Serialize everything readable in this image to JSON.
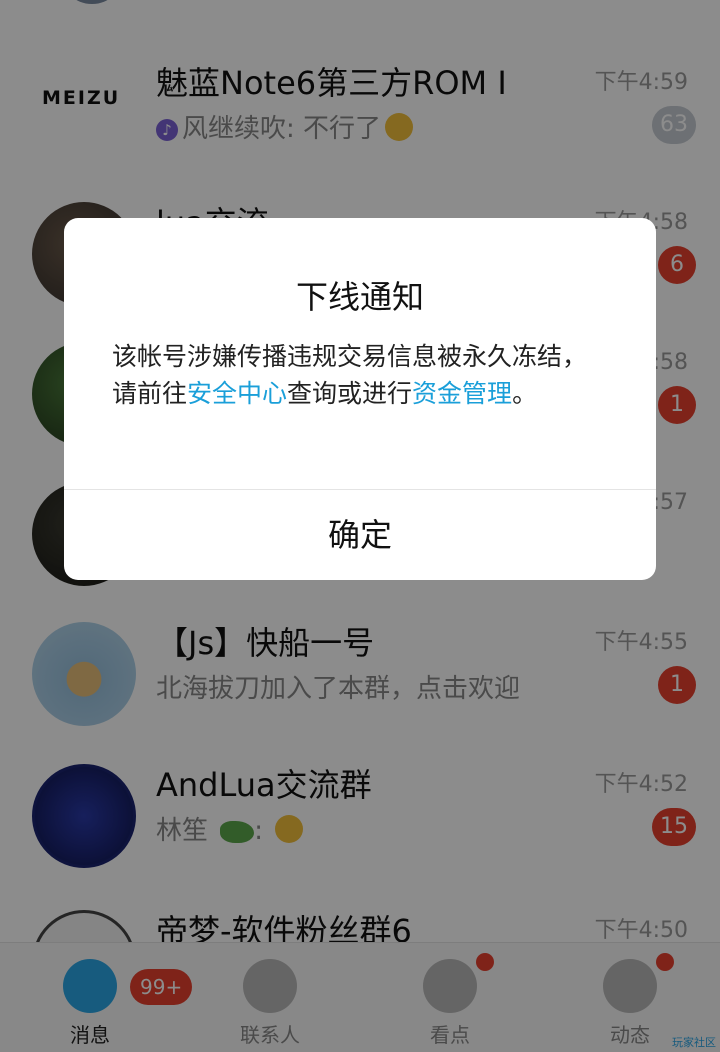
{
  "chats": [
    {
      "name": "魅蓝Note6第三方ROM I",
      "time": "下午4:59",
      "sender": "风继续吹",
      "message": ": 不行了",
      "badge": "63",
      "avatar_logo": "MEIZU"
    },
    {
      "name": "lua交流",
      "time": "下午4:58",
      "message": "",
      "badge": "6"
    },
    {
      "name": "",
      "time": "下午4:58",
      "message": "",
      "badge": "1"
    },
    {
      "name": "",
      "time": "下午4:57",
      "message": "",
      "badge": ""
    },
    {
      "name": "【Js】快船一号",
      "time": "下午4:55",
      "message": "北海拔刀加入了本群，点击欢迎",
      "badge": "1"
    },
    {
      "name": "AndLua交流群",
      "time": "下午4:52",
      "message": "林笙",
      "badge": "15"
    },
    {
      "name": "帝梦-软件粉丝群6",
      "time": "下午4:50",
      "message": "",
      "badge": ""
    }
  ],
  "tabbar": {
    "messages": {
      "label": "消息",
      "badge": "99+"
    },
    "contacts": {
      "label": "联系人"
    },
    "watch": {
      "label": "看点"
    },
    "moments": {
      "label": "动态"
    }
  },
  "dialog": {
    "title": "下线通知",
    "body_part1": "该帐号涉嫌传播违规交易信息被永久冻结，请前往",
    "link1": "安全中心",
    "body_part2": "查询或进行",
    "link2": "资金管理",
    "body_part3": "。",
    "confirm": "确定"
  },
  "watermark": "玩家社区",
  "colors": {
    "accent": "#1a9fd9",
    "badge_red": "#e8412f"
  }
}
